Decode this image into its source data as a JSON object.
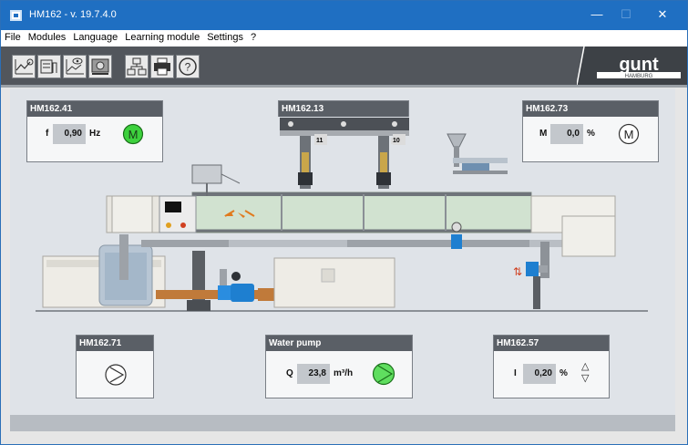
{
  "window": {
    "title": "HM162 - v. 19.7.4.0",
    "minimize_glyph": "—",
    "maximize_glyph": "☐",
    "close_glyph": "✕"
  },
  "menu": {
    "items": [
      "File",
      "Modules",
      "Language",
      "Learning module",
      "Settings",
      "?"
    ]
  },
  "toolbar": {
    "icons": [
      "chart-time-icon",
      "chart-data-icon",
      "chart-eye-icon",
      "camera-icon",
      "network-icon",
      "printer-icon",
      "help-icon"
    ],
    "logo_text": "gunt",
    "logo_subtext": "HAMBURG"
  },
  "panels": {
    "hm162_41": {
      "title": "HM162.41",
      "param": "f",
      "value": "0,90",
      "unit": "Hz",
      "motor_label": "M",
      "motor_color": "#3dd13d"
    },
    "hm162_13": {
      "title": "HM162.13",
      "num_left": "11",
      "num_right": "10"
    },
    "hm162_73": {
      "title": "HM162.73",
      "param": "M",
      "value": "0,0",
      "unit": "%",
      "motor_label": "M"
    },
    "hm162_71": {
      "title": "HM162.71"
    },
    "water_pump": {
      "title": "Water pump",
      "param": "Q",
      "value": "23,8",
      "unit": "m³/h",
      "pump_color": "#5fde5f"
    },
    "hm162_57": {
      "title": "HM162.57",
      "param": "I",
      "value": "0,20",
      "unit": "%",
      "up_glyph": "△",
      "down_glyph": "▽"
    }
  },
  "colors": {
    "title_bar": "#1f6fc2",
    "toolbar": "#52565c",
    "panel_header": "#5a5f66",
    "pump_blue": "#1e7fd0",
    "pipe_copper": "#c07a3a",
    "status_green": "#3dd13d"
  }
}
